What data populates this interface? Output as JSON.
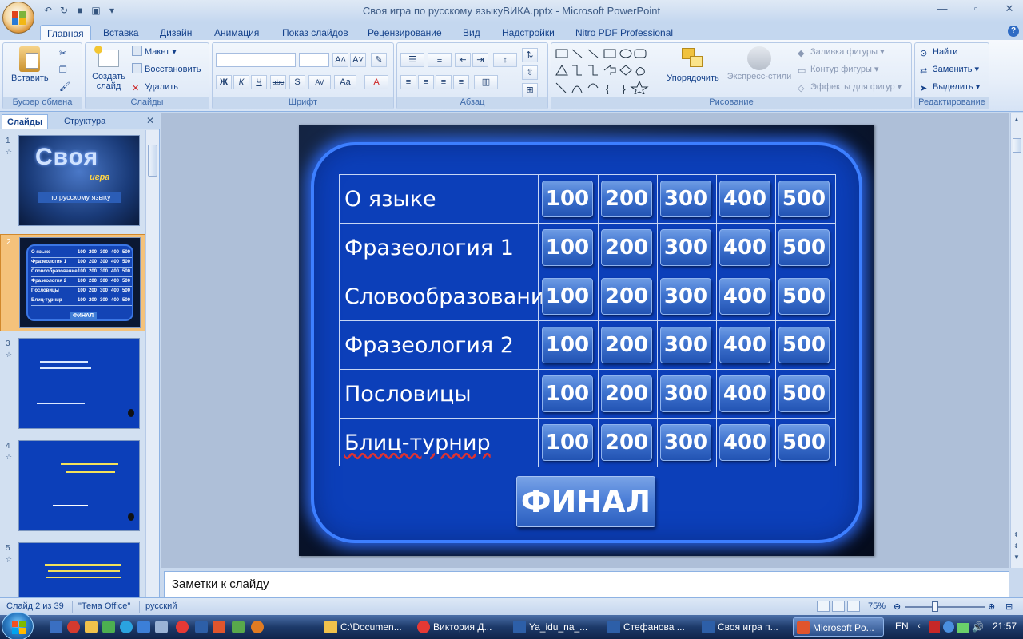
{
  "window": {
    "title": "Своя игра по русскому языкуВИКА.pptx - Microsoft PowerPoint"
  },
  "ribbon_tabs": [
    "Главная",
    "Вставка",
    "Дизайн",
    "Анимация",
    "Показ слайдов",
    "Рецензирование",
    "Вид",
    "Надстройки",
    "Nitro PDF Professional"
  ],
  "ribbon": {
    "clipboard": {
      "paste": "Вставить",
      "group": "Буфер обмена"
    },
    "slides": {
      "new_slide": "Создать слайд",
      "layout": "Макет",
      "reset": "Восстановить",
      "delete": "Удалить",
      "group": "Слайды"
    },
    "font": {
      "group": "Шрифт"
    },
    "paragraph": {
      "group": "Абзац"
    },
    "drawing": {
      "arrange": "Упорядочить",
      "quick_styles": "Экспресс-стили",
      "fill": "Заливка фигуры",
      "outline": "Контур фигуры",
      "effects": "Эффекты для фигур",
      "group": "Рисование"
    },
    "editing": {
      "find": "Найти",
      "replace": "Заменить",
      "select": "Выделить",
      "group": "Редактирование"
    }
  },
  "left_pane": {
    "tabs": [
      "Слайды",
      "Структура"
    ],
    "slide_numbers": [
      "1",
      "2",
      "3",
      "4",
      "5"
    ],
    "thumb1": {
      "title": "Своя",
      "subtitle": "игра",
      "caption": "по русскому языку"
    },
    "thumb2": {
      "rows": [
        "О языке",
        "Фразеология 1",
        "Словообразование",
        "Фразеология 2",
        "Пословицы",
        "Блиц-турнир"
      ],
      "points": [
        "100",
        "200",
        "300",
        "400",
        "500"
      ],
      "final": "ФИНАЛ"
    }
  },
  "slide": {
    "categories": [
      "О языке",
      "Фразеология 1",
      "Словообразование",
      "Фразеология 2",
      "Пословицы",
      "Блиц-турнир"
    ],
    "points": [
      "100",
      "200",
      "300",
      "400",
      "500"
    ],
    "final": "ФИНАЛ"
  },
  "notes": {
    "placeholder": "Заметки к слайду"
  },
  "status": {
    "slide_info": "Слайд 2 из 39",
    "theme": "\"Тема Office\"",
    "language": "русский",
    "zoom": "75%"
  },
  "taskbar": {
    "items": [
      "C:\\Documen...",
      "Виктория Д...",
      "Ya_idu_na_...",
      "Стефанова ...",
      "Своя игра п...",
      "Microsoft Po..."
    ],
    "lang": "EN",
    "clock": "21:57"
  }
}
